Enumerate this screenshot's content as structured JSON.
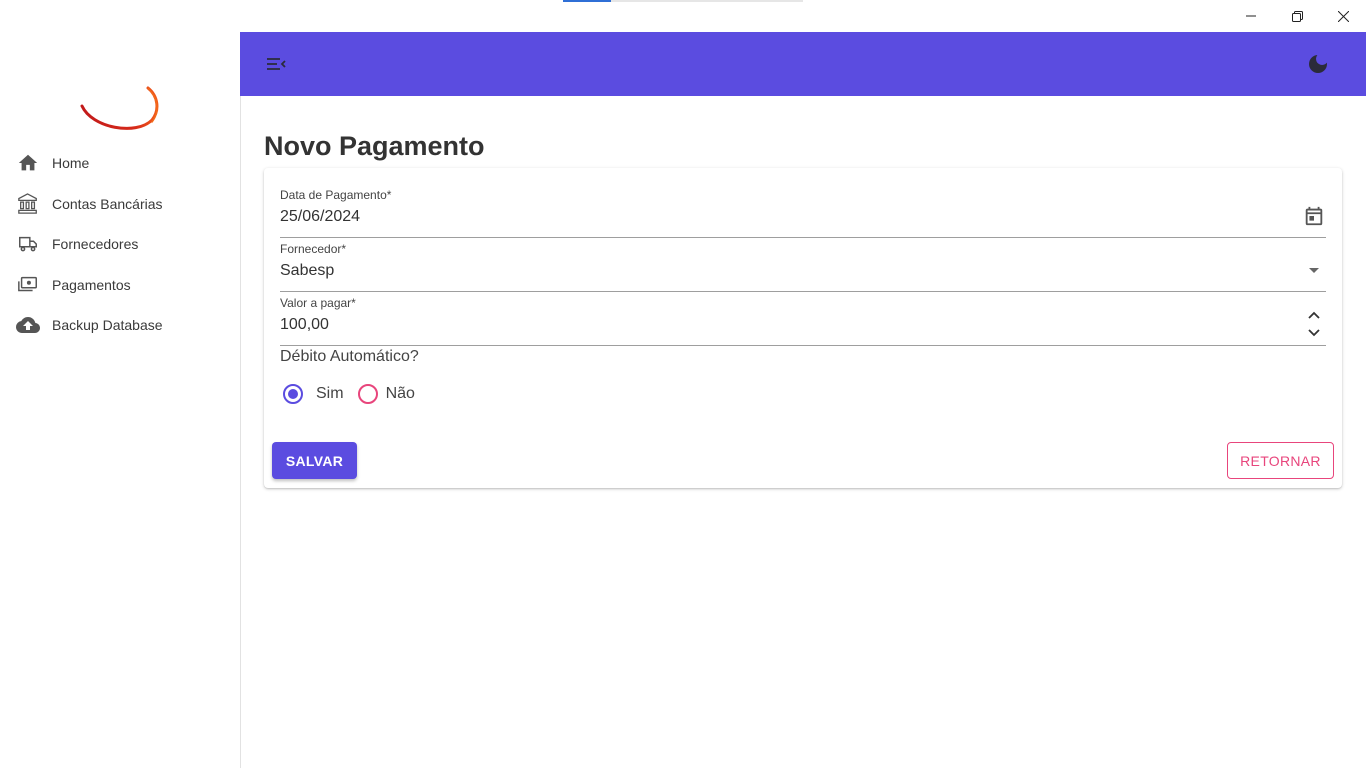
{
  "window": {
    "controls": [
      {
        "name": "minimize-icon"
      },
      {
        "name": "restore-icon"
      },
      {
        "name": "close-icon"
      }
    ]
  },
  "sidebar": {
    "items": [
      {
        "label": "Home",
        "icon": "home-icon"
      },
      {
        "label": "Contas Bancárias",
        "icon": "bank-icon"
      },
      {
        "label": "Fornecedores",
        "icon": "truck-icon"
      },
      {
        "label": "Pagamentos",
        "icon": "payments-icon"
      },
      {
        "label": "Backup Database",
        "icon": "cloud-upload-icon"
      }
    ]
  },
  "appbar": {
    "menu_icon": "menu-collapse-icon",
    "theme_icon": "moon-icon",
    "color": "#5b4ce0"
  },
  "page": {
    "title": "Novo Pagamento"
  },
  "form": {
    "data_pagamento": {
      "label": "Data de Pagamento*",
      "value": "25/06/2024",
      "icon": "calendar-icon"
    },
    "fornecedor": {
      "label": "Fornecedor*",
      "value": "Sabesp",
      "icon": "dropdown-arrow-icon"
    },
    "valor": {
      "label": "Valor a pagar*",
      "value": "100,00",
      "icon": "stepper-icon"
    },
    "debito": {
      "question": "Débito Automático?",
      "options": [
        {
          "label": "Sim",
          "selected": true
        },
        {
          "label": "Não",
          "selected": false
        }
      ]
    },
    "save_label": "SALVAR",
    "return_label": "RETORNAR"
  },
  "colors": {
    "primary": "#5b4ce0",
    "accent": "#e8457c"
  }
}
